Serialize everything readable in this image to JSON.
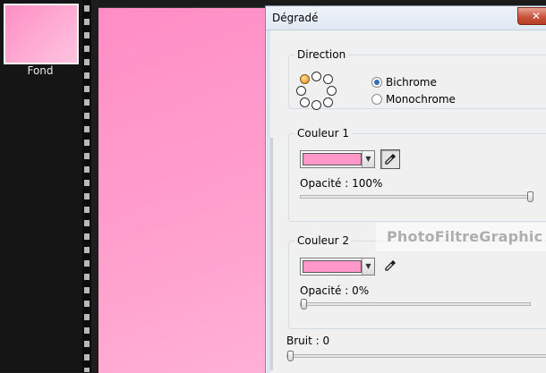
{
  "layers": {
    "items": [
      {
        "name": "Fond"
      }
    ]
  },
  "dialog": {
    "title": "Dégradé",
    "close_label": "✕",
    "direction": {
      "legend": "Direction",
      "selected_index": 0,
      "mode_options": [
        "Bichrome",
        "Monochrome"
      ],
      "selected_mode": "Bichrome"
    },
    "color1": {
      "legend": "Couleur 1",
      "swatch_color": "#ff97c9",
      "opacity_label": "Opacité : 100%",
      "opacity_value": 100
    },
    "color2": {
      "legend": "Couleur 2",
      "swatch_color": "#ff97c9",
      "opacity_label": "Opacité : 0%",
      "opacity_value": 0
    },
    "noise": {
      "label": "Bruit : 0",
      "value": 0
    },
    "watermark": "PhotoFiltreGraphic"
  },
  "colors": {
    "canvas_pink": "#ff97c9",
    "accent_orange": "#f4a234",
    "radio_blue": "#2f6fb8"
  },
  "icons": {
    "eyedropper": "eyedropper-icon",
    "dropdown": "chevron-down-icon"
  }
}
